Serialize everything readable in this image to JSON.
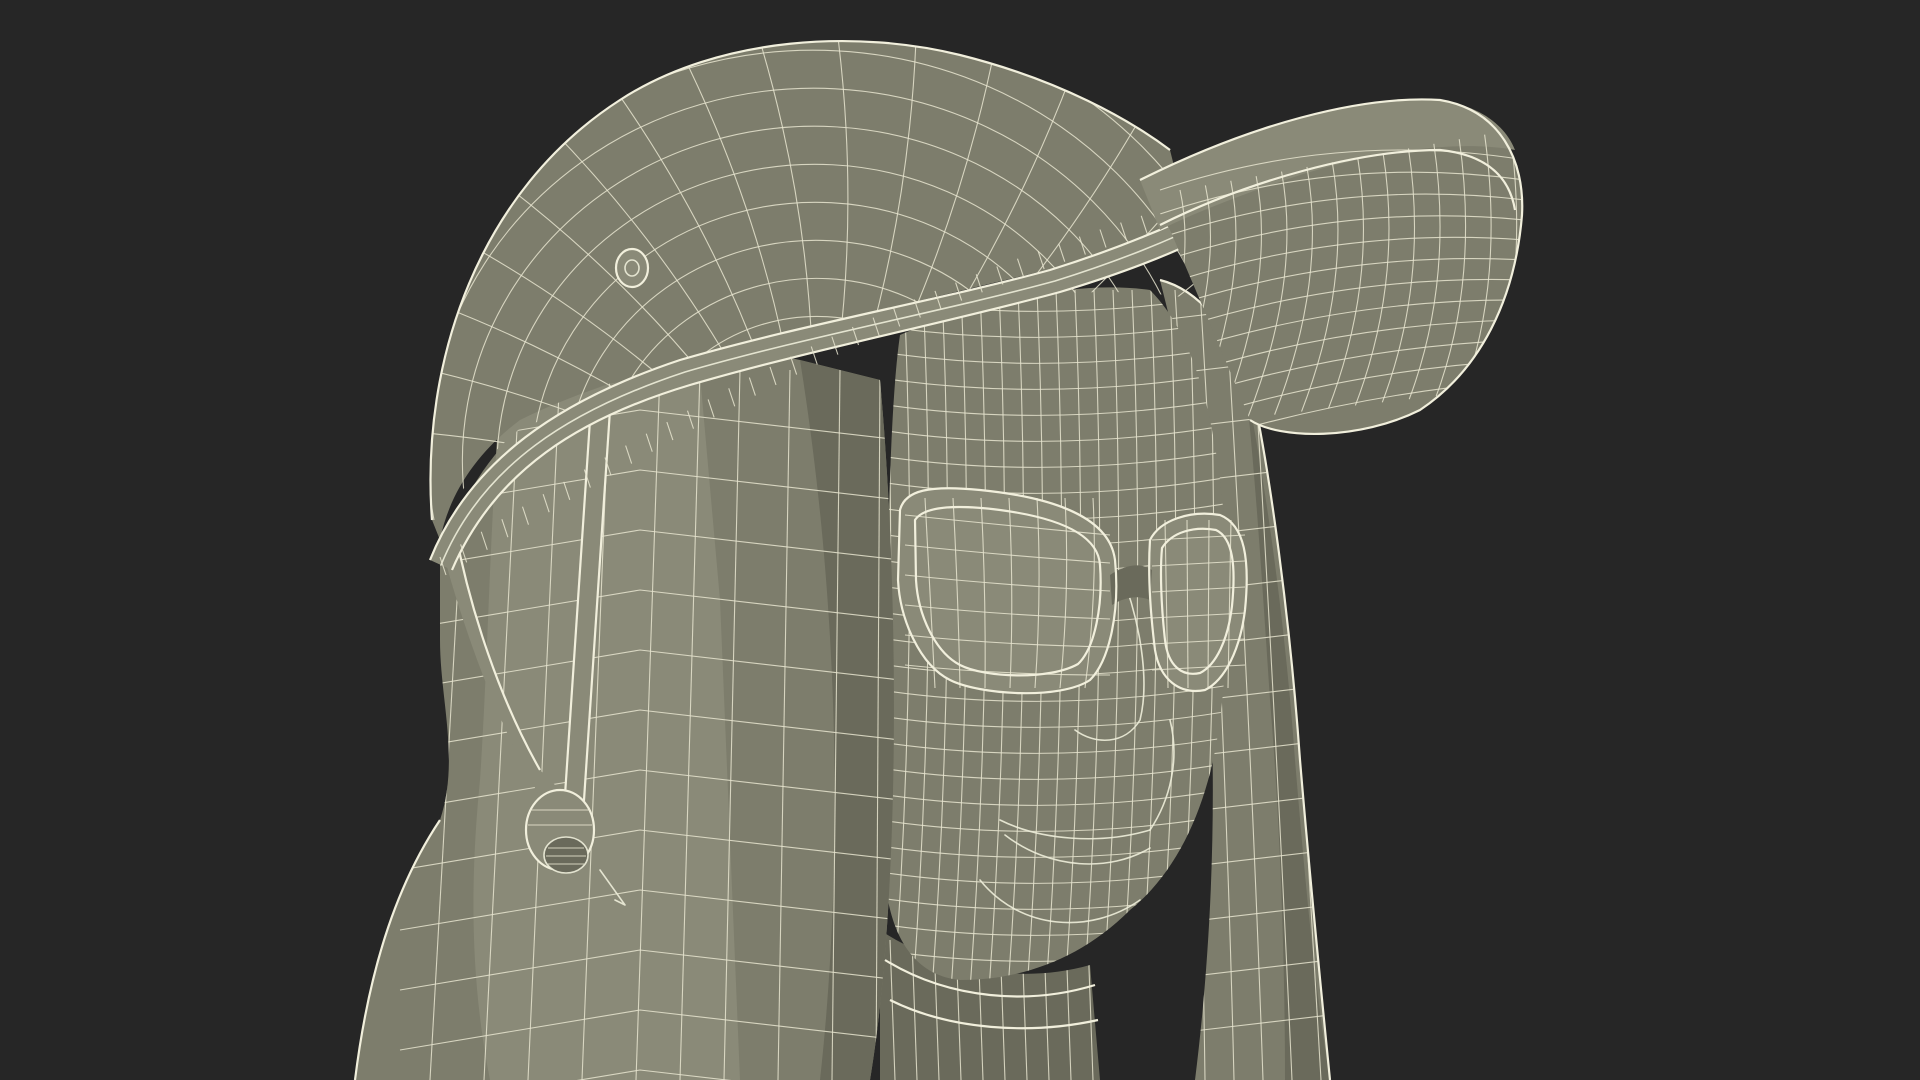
{
  "scene": {
    "background_color": "#262626",
    "surface_color": "#7d7d6c",
    "wire_color": "#ecebd8",
    "subject": "wireframe-head-with-cap-and-goggles"
  }
}
